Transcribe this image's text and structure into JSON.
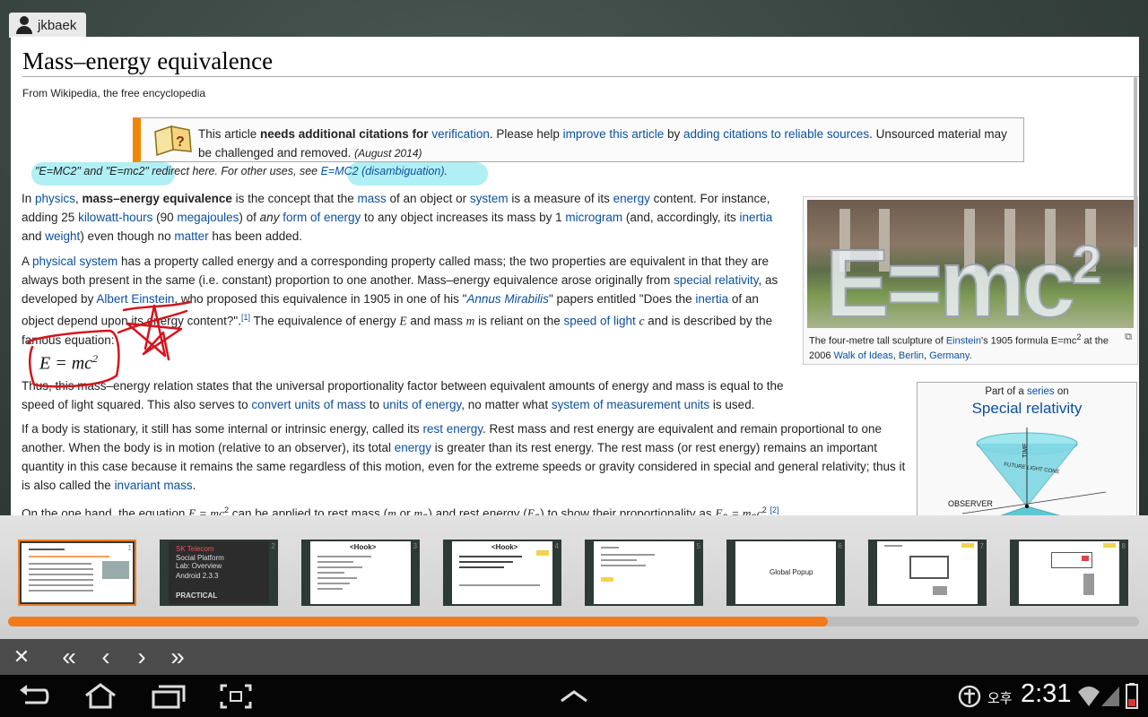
{
  "user": {
    "name": "jkbaek"
  },
  "wiki": {
    "title": "Mass–energy equivalence",
    "from": "From Wikipedia, the free encyclopedia",
    "ambox": {
      "t1": "This article ",
      "bold": "needs additional citations for",
      "link_verification": "verification",
      "t2": ". Please help ",
      "link_improve": "improve this article",
      "t3": " by ",
      "link_adding": "adding citations to reliable sources",
      "t4": ". Unsourced material may be challenged and removed.",
      "date": "(August 2014)"
    },
    "hatnote": {
      "t1": "\"E=MC2\" and \"E=mc2\" redirect here. For other uses, see ",
      "link": "E=MC2 (disambiguation)",
      "t2": "."
    },
    "p1": {
      "a": "In ",
      "l1": "physics",
      "b": ", ",
      "bold": "mass–energy equivalence",
      "c": " is the concept that the ",
      "l2": "mass",
      "d": " of an object or ",
      "l3": "system",
      "e": " is a measure of its ",
      "l4": "energy",
      "f": " content. For instance, adding 25 ",
      "l5": "kilowatt-hours",
      "g": " (90 ",
      "l6": "megajoules",
      "h": ") of ",
      "i_em": "any",
      "l7": "form of energy",
      "j": " to any object increases its mass by 1 ",
      "l8": "microgram",
      "k": " (and, accordingly, its ",
      "l9": "inertia",
      "m": " and ",
      "l10": "weight",
      "n": ") even though no ",
      "l11": "matter",
      "o": " has been added."
    },
    "p2": {
      "a": "A ",
      "l1": "physical system",
      "b": " has a property called energy and a corresponding property called mass; the two properties are equivalent in that they are always both present in the same (i.e. constant) proportion to one another. Mass–energy equivalence arose originally from ",
      "l2": "special relativity",
      "c": ", as developed by ",
      "l3": "Albert Einstein",
      "d": ", who proposed this equivalence in 1905 in one of his \"",
      "l4": "Annus Mirabilis",
      "e": "\" papers entitled \"Does the ",
      "l5": "inertia",
      "f": " of an object depend upon its energy content?\".",
      "ref": "[1]",
      "g": " The equivalence of energy ",
      "E": "E",
      "h": " and mass ",
      "m": "m",
      "i": " is reliant on the ",
      "l6": "speed of light",
      "j": " ",
      "c_var": "c",
      "k": " and is described by the famous equation:"
    },
    "formula": {
      "lhs": "E = mc",
      "exp": "2"
    },
    "p3": {
      "a": "Thus, this mass–energy relation states that the universal proportionality factor between equivalent amounts of energy and mass is equal to the speed of light squared. This also serves to ",
      "l1": "convert units of mass",
      "b": " to ",
      "l2": "units of energy",
      "c": ", no matter what ",
      "l3": "system of measurement units",
      "d": " is used."
    },
    "p4": {
      "a": "If a body is stationary, it still has some internal or intrinsic energy, called its ",
      "l1": "rest energy",
      "b": ". Rest mass and rest energy are equivalent and remain proportional to one another. When the body is in motion (relative to an observer), its total ",
      "l2": "energy",
      "c": " is greater than its rest energy. The rest mass (or rest energy) remains an important quantity in this case because it remains the same regardless of this motion, even for the extreme speeds or gravity considered in special and general relativity; thus it is also called the ",
      "l3": "invariant mass",
      "d": "."
    },
    "p5": {
      "a": "On the one hand, the equation ",
      "eq": "E = mc",
      "sq": "2",
      "b": " can be applied to rest mass (",
      "m": "m",
      "c": " or ",
      "m0": "m",
      "sub0": "0",
      "d": ") and rest energy (",
      "E0": "E",
      "sub1": "0",
      "e": ") to show their proportionality as ",
      "eq2": "E",
      "sub2": "0",
      "eq3": " = m",
      "sub3": "0",
      "eq4": "c",
      "sq2": "2",
      "f": ".",
      "ref": "[2]"
    },
    "thumb": {
      "photo_text": "E=mc",
      "photo_exp": "2",
      "c1": "The four-metre tall sculpture of ",
      "l1": "Einstein",
      "c2": "'s 1905 formula E=mc",
      "c2sup": "2",
      "c3": " at the 2006 ",
      "l2": "Walk of Ideas",
      "c4": ", ",
      "l3": "Berlin",
      "c5": ", ",
      "l4": "Germany",
      "c6": "."
    },
    "series": {
      "part_a": "Part of a ",
      "part_link": "series",
      "part_b": " on",
      "title": "Special relativity",
      "time_label": "TIME",
      "future_label": "FUTURE LIGHT CONE",
      "observer_label": "OBSERVER"
    }
  },
  "filmstrip": {
    "progress": 0.725,
    "thumbs": [
      {
        "num": "1",
        "kind": "wiki",
        "active": true
      },
      {
        "num": "2",
        "kind": "dark",
        "lines": [
          "SK Telecom",
          "Social Platform",
          "Lab: Overview",
          "Android 2.3.3",
          "PRACTICAL"
        ]
      },
      {
        "num": "3",
        "kind": "doc",
        "heading": "<Hook>"
      },
      {
        "num": "4",
        "kind": "doc",
        "heading": "<Hook>"
      },
      {
        "num": "5",
        "kind": "doc",
        "heading": ""
      },
      {
        "num": "6",
        "kind": "label",
        "heading": "Global Popup"
      },
      {
        "num": "7",
        "kind": "window",
        "heading": ""
      },
      {
        "num": "8",
        "kind": "window2",
        "heading": ""
      }
    ]
  },
  "toolbar": {
    "close": "✕",
    "first": "«",
    "prev": "‹",
    "next": "›",
    "last": "»"
  },
  "status": {
    "ampm": "오후",
    "time": "2:31"
  },
  "colors": {
    "accent": "#f07b1e",
    "link": "#0b4f9e",
    "highlight": "#50dce6",
    "ink": "#d4141e"
  }
}
